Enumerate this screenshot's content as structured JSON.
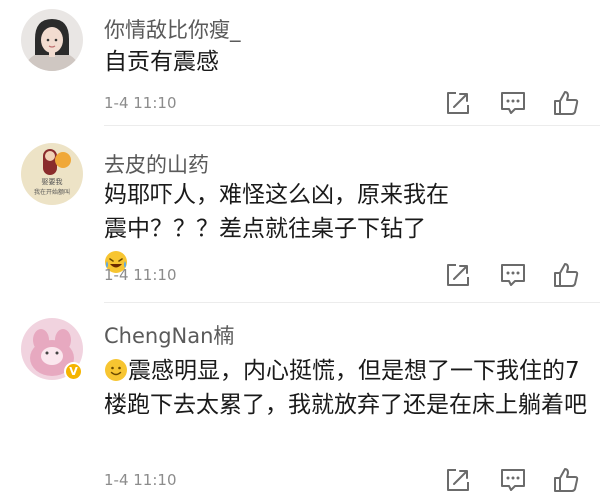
{
  "comments": [
    {
      "username": "你情敌比你瘦_",
      "text": "自贡有震感",
      "time": "1-4 11:10",
      "avatar_text": ""
    },
    {
      "username": "去皮的山药",
      "text": "妈耶吓人，难怪这么凶，原来我在震中？？？差点就往桌子下钻了",
      "time": "1-4 11:10",
      "avatar_text": "娶要我\n我在开始额叫"
    },
    {
      "username": "ChengNan楠",
      "text": "震感明显，内心挺慌，但是想了一下我住的7楼跑下去太累了，我就放弃了还是在床上躺着吧",
      "time": "1-4 11:10",
      "avatar_text": ""
    }
  ],
  "colors": {
    "username": "#5a5a5a",
    "text": "#1a1a1a",
    "meta": "#8c8c8c",
    "icon": "#6b6b6b",
    "badge": "#f5b400"
  },
  "icons": {
    "share": "share-icon",
    "comment": "comment-icon",
    "like": "thumbs-up-icon",
    "laugh_emoji": "laughing-tears-emoji-icon",
    "smile_emoji": "smile-emoji-icon",
    "verified": "verified-badge-icon"
  }
}
